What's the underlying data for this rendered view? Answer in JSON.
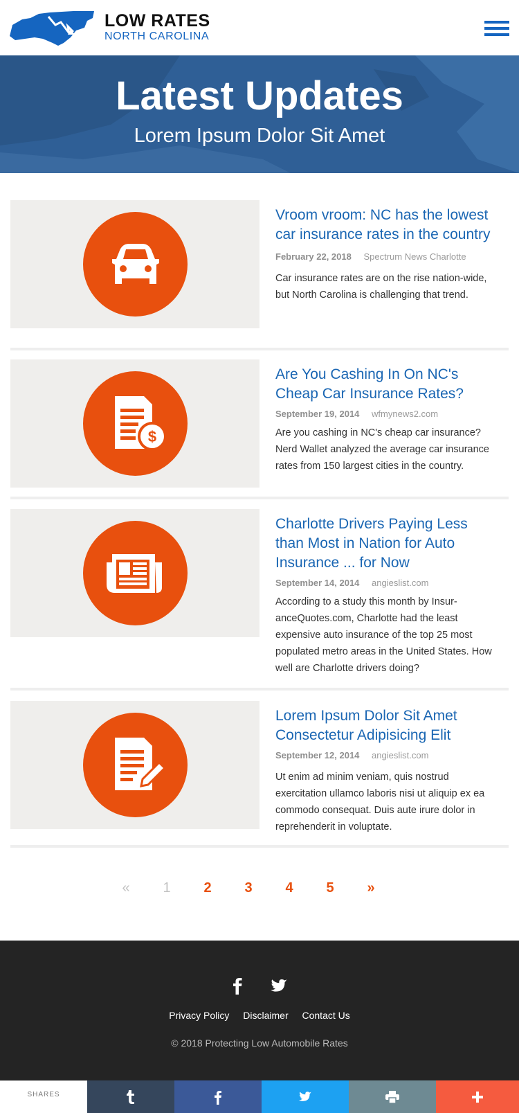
{
  "brand": {
    "line1": "LOW RATES",
    "line2": "NORTH CAROLINA",
    "primary_color": "#1565c0",
    "accent_color": "#e8500e"
  },
  "header": {
    "menu_icon": "hamburger-icon"
  },
  "hero": {
    "title": "Latest Updates",
    "subtitle": "Lorem Ipsum Dolor Sit Amet"
  },
  "articles": [
    {
      "icon": "car-icon",
      "title": "Vroom vroom: NC has the lowest car insurance rates in the country",
      "date": "February 22, 2018",
      "source": "Spectrum News Charlotte",
      "description": "Car insurance rates are on the rise nation-wide, but North Carolina is challenging that trend."
    },
    {
      "icon": "invoice-dollar-icon",
      "title": "Are You Cashing In On NC's Cheap Car Insurance Rates?",
      "date": "September 19, 2014",
      "source": "wfmynews2.com",
      "description": "Are you cashing in NC's cheap car insurance? Nerd Wallet analyzed the average car insurance rates from 150 largest cities in the country."
    },
    {
      "icon": "newspaper-icon",
      "title": "Charlotte Drivers Paying Less than Most in Nation for Auto Insurance ... for Now",
      "date": "September 14, 2014",
      "source": "angieslist.com",
      "description": "According to a study this month by Insur-anceQuotes.com, Charlotte had the least expensive auto insurance of the top 25 most populated metro areas in the United States. How well are Charlotte drivers doing?"
    },
    {
      "icon": "document-pen-icon",
      "title": "Lorem Ipsum Dolor Sit Amet Consectetur Adipisicing Elit",
      "date": "September 12, 2014",
      "source": "angieslist.com",
      "description": "Ut enim ad minim veniam, quis nostrud exercitation ullamco laboris nisi ut aliquip ex ea commodo consequat. Duis aute irure dolor in reprehenderit in voluptate."
    }
  ],
  "pagination": {
    "prev": "«",
    "pages": [
      "1",
      "2",
      "3",
      "4",
      "5"
    ],
    "current": "1",
    "next": "»"
  },
  "footer": {
    "links": [
      "Privacy Policy",
      "Disclaimer",
      "Contact Us"
    ],
    "copyright": "© 2018 Protecting Low Automobile Rates"
  },
  "sharebar": {
    "label": "SHARES",
    "colors": {
      "tumblr": "#35465c",
      "facebook": "#3b5998",
      "twitter": "#1da1f2",
      "print": "#6e8a93",
      "more": "#f55b3f"
    }
  }
}
